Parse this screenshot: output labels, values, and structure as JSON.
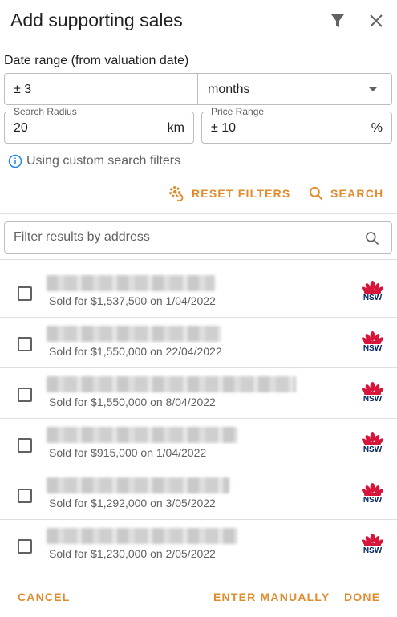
{
  "header": {
    "title": "Add supporting sales",
    "filter_icon": "filter-icon",
    "close_icon": "close-icon"
  },
  "date_range": {
    "label": "Date range (from valuation date)",
    "value": "± 3",
    "unit": "months",
    "unit_icon": "chevron-down-icon"
  },
  "search_radius": {
    "label": "Search Radius",
    "value": "20",
    "suffix": "km"
  },
  "price_range": {
    "label": "Price Range",
    "value": "± 10",
    "suffix": "%"
  },
  "info": {
    "icon": "info-icon",
    "text": "Using custom search filters"
  },
  "actions": {
    "reset_label": "RESET FILTERS",
    "reset_icon": "settings-reset-icon",
    "search_label": "SEARCH",
    "search_icon": "search-icon"
  },
  "filter_input": {
    "placeholder": "Filter results by address",
    "value": ""
  },
  "results": [
    {
      "sold_text": "Sold for $1,537,500 on 1/04/2022",
      "badge": "NSW",
      "checked": false
    },
    {
      "sold_text": "Sold for $1,550,000 on 22/04/2022",
      "badge": "NSW",
      "checked": false
    },
    {
      "sold_text": "Sold for $1,550,000 on 8/04/2022",
      "badge": "NSW",
      "checked": false
    },
    {
      "sold_text": "Sold for $915,000 on 1/04/2022",
      "badge": "NSW",
      "checked": false
    },
    {
      "sold_text": "Sold for $1,292,000 on 3/05/2022",
      "badge": "NSW",
      "checked": false
    },
    {
      "sold_text": "Sold for $1,230,000 on 2/05/2022",
      "badge": "NSW",
      "checked": false
    }
  ],
  "footer": {
    "cancel_label": "CANCEL",
    "manual_label": "ENTER MANUALLY",
    "done_label": "DONE"
  },
  "colors": {
    "accent": "#e08b2e",
    "nsw_red": "#d7153a",
    "nsw_blue": "#002664"
  }
}
